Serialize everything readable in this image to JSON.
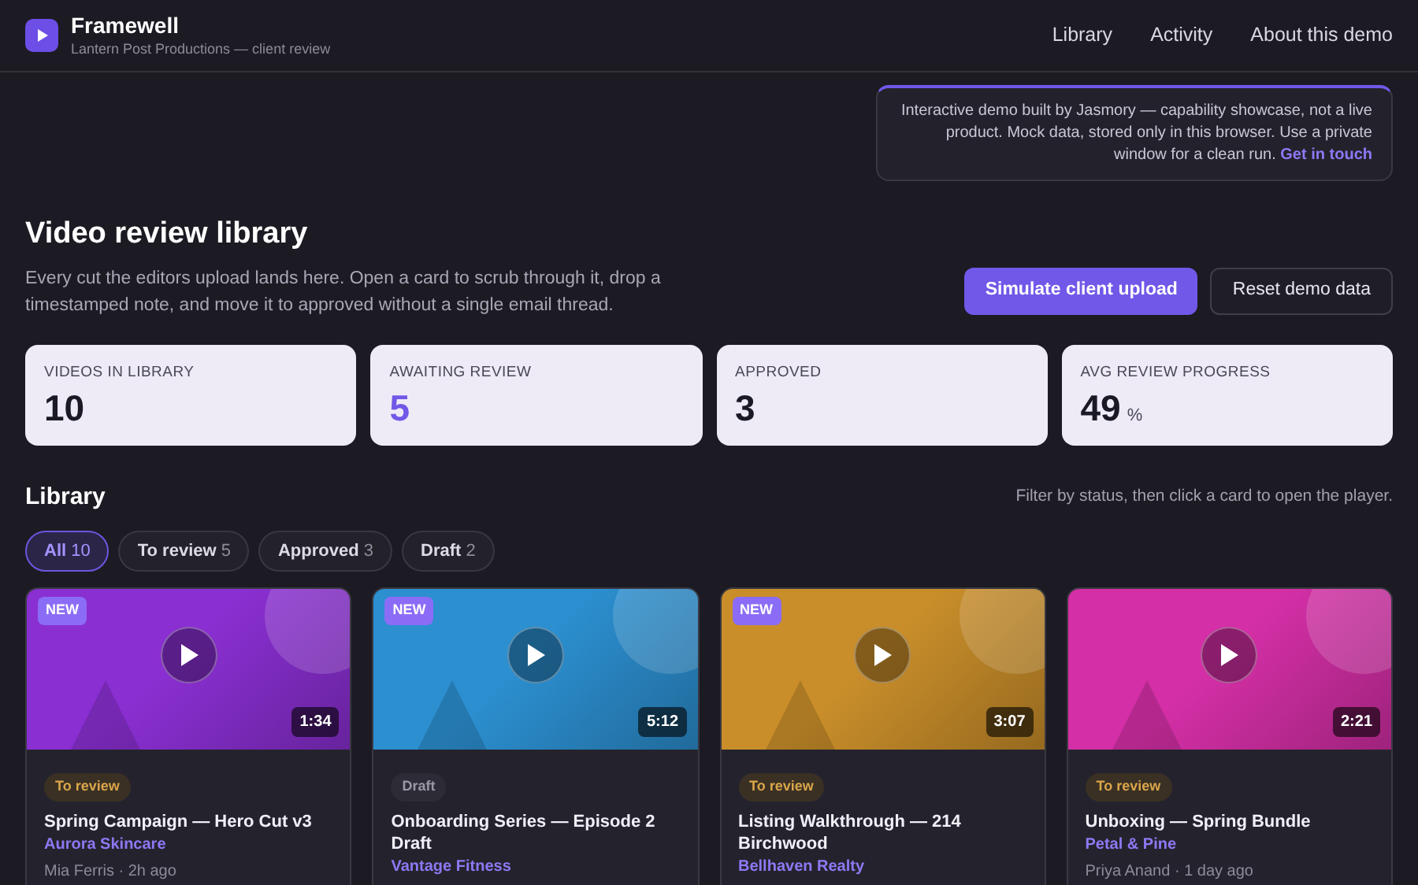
{
  "brand": {
    "name": "Framewell",
    "subtitle": "Lantern Post Productions — client review"
  },
  "nav": [
    "Library",
    "Activity",
    "About this demo"
  ],
  "notice": {
    "text": "Interactive demo built by Jasmory — capability showcase, not a live product. Mock data, stored only in this browser. Use a private window for a clean run.",
    "link": "Get in touch"
  },
  "page": {
    "title": "Video review library",
    "description": "Every cut the editors upload lands here. Open a card to scrub through it, drop a timestamped note, and move it to approved without a single email thread.",
    "buttons": [
      {
        "label": "Simulate client upload",
        "kind": "primary"
      },
      {
        "label": "Reset demo data",
        "kind": "secondary"
      }
    ]
  },
  "stats": [
    {
      "label": "VIDEOS IN LIBRARY",
      "value": "10",
      "highlight": false
    },
    {
      "label": "AWAITING REVIEW",
      "value": "5",
      "highlight": true
    },
    {
      "label": "APPROVED",
      "value": "3",
      "highlight": false
    },
    {
      "label": "AVG REVIEW PROGRESS",
      "value": "49",
      "unit": "%",
      "highlight": false
    }
  ],
  "library": {
    "title": "Library",
    "hint": "Filter by status, then click a card to open the player.",
    "filters": [
      {
        "label": "All",
        "count": "10",
        "selected": true
      },
      {
        "label": "To review",
        "count": "5",
        "selected": false
      },
      {
        "label": "Approved",
        "count": "3",
        "selected": false
      },
      {
        "label": "Draft",
        "count": "2",
        "selected": false
      }
    ],
    "cards": [
      {
        "badge": "NEW",
        "duration": "1:34",
        "color": "#8a2fd2",
        "status": "To review",
        "kind": "review",
        "title": "Spring Campaign — Hero Cut v3",
        "client": "Aurora Skincare",
        "meta": "Mia Ferris · 2h ago"
      },
      {
        "badge": "NEW",
        "duration": "5:12",
        "color": "#2c8fd0",
        "status": "Draft",
        "kind": "draft",
        "title": "Onboarding Series — Episode 2 Draft",
        "client": "Vantage Fitness"
      },
      {
        "badge": "NEW",
        "duration": "3:07",
        "color": "#c98e2a",
        "status": "To review",
        "kind": "review",
        "title": "Listing Walkthrough — 214 Birchwood",
        "client": "Bellhaven Realty"
      },
      {
        "duration": "2:21",
        "color": "#d42fa6",
        "status": "To review",
        "kind": "review",
        "title": "Unboxing — Spring Bundle",
        "client": "Petal & Pine",
        "meta": "Priya Anand · 1 day ago"
      }
    ]
  }
}
